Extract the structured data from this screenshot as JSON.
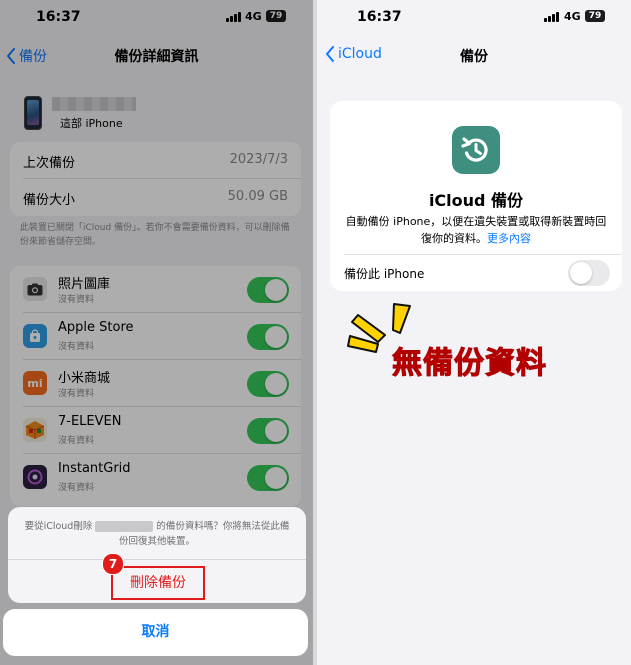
{
  "left": {
    "status": {
      "time": "16:37",
      "network": "4G",
      "battery": "79"
    },
    "nav": {
      "back_label": "備份",
      "title": "備份詳細資訊"
    },
    "device": {
      "label": "這部 iPhone"
    },
    "info_rows": [
      {
        "label": "上次備份",
        "value": "2023/7/3"
      },
      {
        "label": "備份大小",
        "value": "50.09 GB"
      }
    ],
    "info_note": "此裝置已關閉「iCloud 備份」。若你不會需要備份資料，可以刪除備份來節省儲存空間。",
    "apps": [
      {
        "name": "照片圖庫",
        "sub": "沒有資料",
        "toggle": true
      },
      {
        "name": "Apple Store",
        "sub": "沒有資料",
        "toggle": true
      },
      {
        "name": "小米商城",
        "sub": "沒有資料",
        "toggle": true
      },
      {
        "name": "7-ELEVEN",
        "sub": "沒有資料",
        "toggle": true
      },
      {
        "name": "InstantGrid",
        "sub": "沒有資料",
        "toggle": true
      }
    ],
    "sheet": {
      "msg_prefix": "要從iCloud刪除",
      "msg_suffix": "的備份資料嗎？你將無法從此備份回復其他裝置。",
      "delete_label": "刪除備份",
      "step_badge": "7",
      "cancel_label": "取消"
    }
  },
  "right": {
    "status": {
      "time": "16:37",
      "network": "4G",
      "battery": "79"
    },
    "nav": {
      "back_label": "iCloud",
      "title": "備份"
    },
    "card": {
      "title": "iCloud 備份",
      "desc": "自動備份 iPhone，以便在遺失裝置或取得新裝置時回復你的資料。",
      "link": "更多內容",
      "row_label": "備份此 iPhone",
      "toggle": false
    },
    "annotation": "無備份資料"
  },
  "colors": {
    "accent": "#0a7aff",
    "toggle_on": "#34c759",
    "destructive": "#e02020",
    "annotation": "#e8130b"
  }
}
